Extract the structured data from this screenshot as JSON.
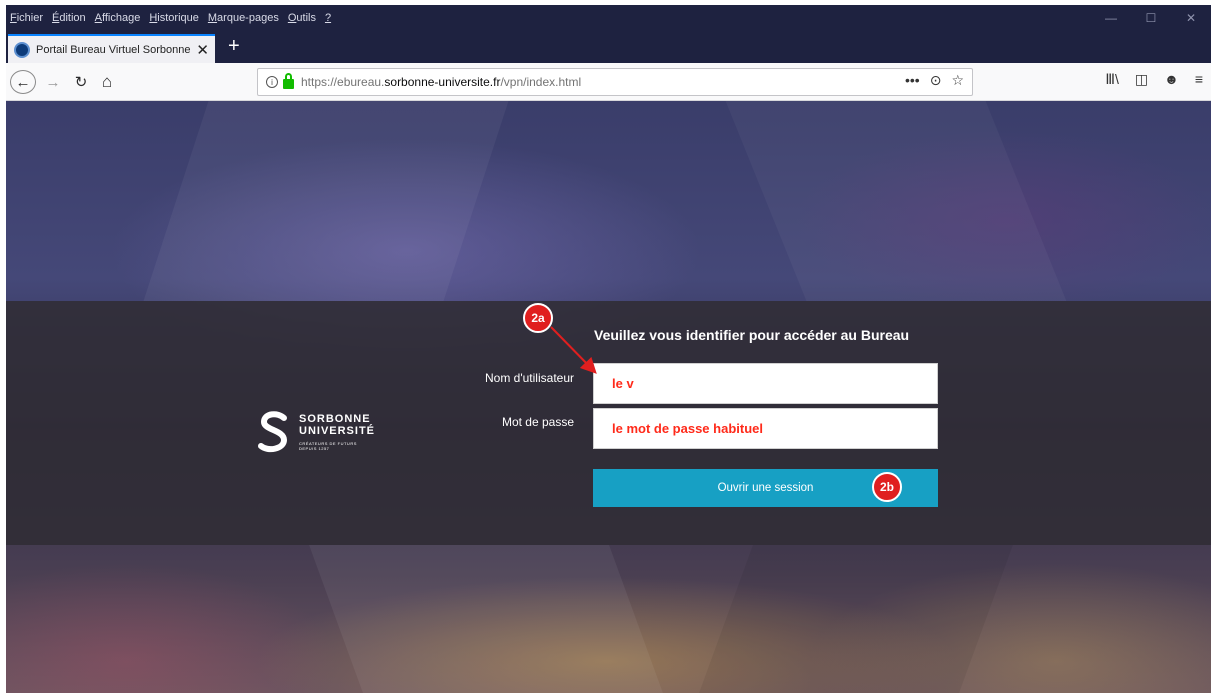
{
  "menubar": {
    "items": [
      {
        "accel": "F",
        "rest": "ichier"
      },
      {
        "accel": "É",
        "rest": "dition"
      },
      {
        "accel": "A",
        "rest": "ffichage"
      },
      {
        "accel": "H",
        "rest": "istorique"
      },
      {
        "accel": "M",
        "rest": "arque-pages"
      },
      {
        "accel": "O",
        "rest": "utils"
      },
      {
        "accel": "?",
        "rest": ""
      }
    ]
  },
  "window_controls": {
    "minimize": "—",
    "maximize": "☐",
    "close": "✕"
  },
  "tab": {
    "title": "Portail Bureau Virtuel Sorbonne",
    "close": "✕"
  },
  "newtab": "+",
  "nav": {
    "back": "←",
    "forward": "→",
    "reload": "↻",
    "home": "⌂"
  },
  "urlbar": {
    "prefix": "https://ebureau.",
    "domain": "sorbonne-universite.fr",
    "rest": "/vpn/index.html",
    "info": "i",
    "actions": [
      "•••",
      "⊙",
      "☆"
    ]
  },
  "toolbar_right": [
    "Ⅲ\\",
    "◫",
    "☻",
    "≡"
  ],
  "logo": {
    "line1": "SORBONNE",
    "line2": "UNIVERSITÉ",
    "tagline1": "CRÉATEURS DE FUTURS",
    "tagline2": "DEPUIS 1257"
  },
  "login": {
    "title": "Veuillez vous identifier pour accéder au Bureau",
    "username_label": "Nom d'utilisateur",
    "username_value": "le v",
    "password_label": "Mot de passe",
    "password_value": "le mot de passe habituel",
    "submit_label": "Ouvrir une session"
  },
  "annotations": {
    "step_a": "2a",
    "step_b": "2b",
    "color": "#e01f1f"
  }
}
